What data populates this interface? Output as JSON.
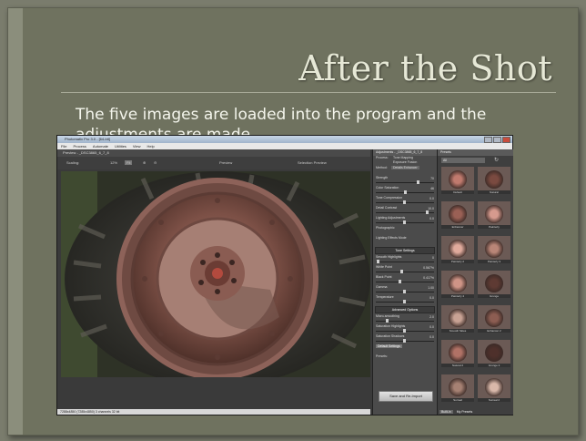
{
  "slide": {
    "title": "After the Shot",
    "bullet": "The five images are loaded into the program and the adjustments are made."
  },
  "app": {
    "title": "Photomatix Pro 3.0 - [64-bit]",
    "menu": [
      "File",
      "Process",
      "Automate",
      "Utilities",
      "View",
      "Help"
    ],
    "document_tab": "Preview - _DSC3865_6_7_8",
    "toolbar": {
      "zoom_label": "Scaling:",
      "zoom_value": "12%",
      "fit": "Fit",
      "preview_label": "Preview",
      "selection_preview": "Selection Preview"
    },
    "status": "7288x4850 (7285x4850) 3 channels 32 bit",
    "adjustments": {
      "header": "Adjustments - _DSC3865_6_7_8",
      "process_label": "Process:",
      "process_options": [
        "Tone Mapping",
        "Exposure Fusion"
      ],
      "method_label": "Method:",
      "method_value": "Details Enhancer",
      "rows": [
        {
          "label": "Strength",
          "value": "70"
        },
        {
          "label": "Color Saturation",
          "value": "46"
        },
        {
          "label": "Tone Compression",
          "value": "0.0"
        },
        {
          "label": "Detail Contrast",
          "value": "10.0"
        },
        {
          "label": "Lighting Adjustments",
          "value": "0.0"
        }
      ],
      "photographic": "Photographic",
      "lighting_effects": "Lighting Effects Mode",
      "section_tone": "Tone Settings",
      "tone_rows": [
        {
          "label": "Smooth Highlights",
          "value": "0"
        },
        {
          "label": "White Point",
          "value": "0.567%"
        },
        {
          "label": "Black Point",
          "value": "0.417%"
        },
        {
          "label": "Gamma",
          "value": "1.00"
        },
        {
          "label": "Temperature",
          "value": "0.0"
        }
      ],
      "section_advanced": "Advanced Options",
      "advanced_rows": [
        {
          "label": "Micro-smoothing",
          "value": "2.0"
        },
        {
          "label": "Saturation Highlights",
          "value": "0.0"
        },
        {
          "label": "Saturation Shadows",
          "value": "0.0"
        }
      ],
      "default_button": "Default Settings",
      "presets_label": "Presets:",
      "save_button": "Save and Re-Import"
    },
    "previews": {
      "header": "Presets",
      "dropdown": "All",
      "thumbs": [
        "Default",
        "Natural",
        "Enhancer",
        "Painterly",
        "Painterly 2",
        "Painterly 3",
        "Painterly 4",
        "Grunge",
        "Smooth Skies",
        "Enhancer 2",
        "Natural 2",
        "Grunge 2",
        "Surreal",
        "Surreal 2"
      ],
      "footer_tabs": [
        "Built-in",
        "My Presets"
      ]
    }
  }
}
